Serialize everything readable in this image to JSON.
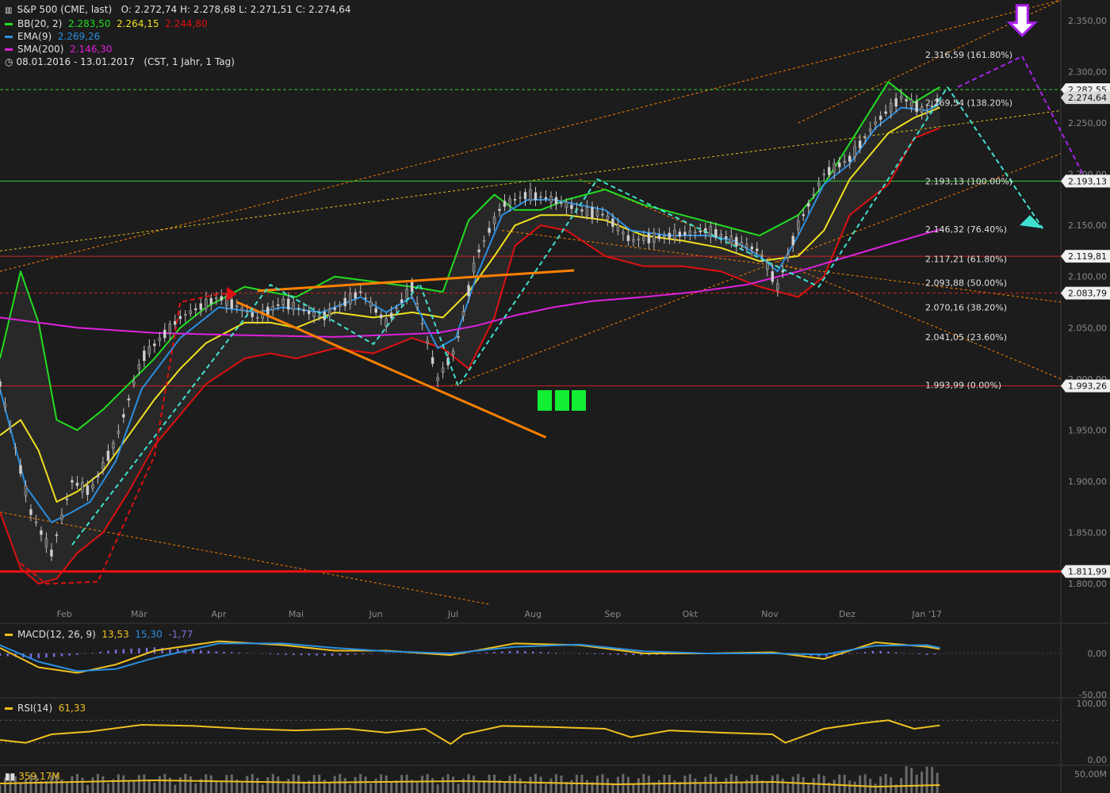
{
  "header": {
    "symbol_icon": "candlestick-icon",
    "symbol": "S&P 500 (CME, last)",
    "ohlc": "O: 2.272,74   H: 2.278,68   L: 2.271,51   C: 2.274,64",
    "bb_label": "BB(20, 2)",
    "bb_values": [
      "2.283,50",
      "2.264,15",
      "2.244,80"
    ],
    "ema_label": "EMA(9)",
    "ema_value": "2.269,26",
    "sma_label": "SMA(200)",
    "sma_value": "2.146,30",
    "clock_icon": "clock-icon",
    "range": "08.01.2016 - 13.01.2017",
    "range_detail": "(CST, 1 Jahr, 1 Tag)"
  },
  "colors": {
    "background": "#1c1c1c",
    "bb_upper": "#22dd22",
    "bb_lower": "#dd1111",
    "bb_mid": "#f0e020",
    "ema": "#2a8ee0",
    "sma": "#dd22dd",
    "trend_orange": "#ff8000",
    "trend_cyan": "#40e0d0",
    "forecast_purple": "#aa22ee",
    "grid_green": "#33cc33",
    "grid_red": "#cc2222",
    "macd": "#f0c020",
    "macd_signal": "#2a8ee0",
    "macd_hist": "#7a70e0",
    "rsi": "#f0c020",
    "green_blocks": "#11ee33"
  },
  "chart_data": {
    "type": "line",
    "title": "S&P 500 (CME, last)",
    "xlabel": "",
    "ylabel": "",
    "ylim": [
      1780,
      2370
    ],
    "y_ticks": [
      1800,
      1850,
      1900,
      1950,
      2000,
      2050,
      2100,
      2150,
      2200,
      2250,
      2300,
      2350
    ],
    "y_tick_labels": [
      "1.800,00",
      "1.850,00",
      "1.900,00",
      "1.950,00",
      "2.000,00",
      "2.050,00",
      "2.100,00",
      "2.150,00",
      "2.200,00",
      "2.250,00",
      "2.300,00",
      "2.350,00"
    ],
    "x_labels": [
      "Feb",
      "Mär",
      "Apr",
      "Mai",
      "Jun",
      "Jul",
      "Aug",
      "Sep",
      "Okt",
      "Nov",
      "Dez",
      "Jan '17"
    ],
    "x_label_days": [
      25,
      54,
      85,
      115,
      146,
      176,
      207,
      238,
      268,
      299,
      329,
      360
    ],
    "x_days_range": [
      0,
      412
    ],
    "grid": false,
    "legend_position": "top-left",
    "series": [
      {
        "name": "S&P 500",
        "x": [
          0,
          12,
          20,
          28,
          35,
          45,
          55,
          70,
          85,
          100,
          110,
          125,
          140,
          150,
          160,
          170,
          177,
          185,
          195,
          205,
          215,
          225,
          235,
          245,
          260,
          275,
          285,
          295,
          302,
          310,
          320,
          330,
          340,
          350,
          360,
          365
        ],
        "y": [
          1995,
          1870,
          1830,
          1900,
          1890,
          1940,
          2020,
          2060,
          2080,
          2060,
          2075,
          2060,
          2085,
          2055,
          2090,
          2000,
          2030,
          2120,
          2170,
          2180,
          2175,
          2165,
          2160,
          2135,
          2140,
          2145,
          2135,
          2125,
          2090,
          2150,
          2200,
          2215,
          2250,
          2275,
          2260,
          2275
        ]
      },
      {
        "name": "BB(20, 2)",
        "x": [
          0,
          8,
          15,
          22,
          30,
          40,
          50,
          60,
          70,
          80,
          95,
          105,
          115,
          130,
          145,
          160,
          172,
          182,
          192,
          200,
          210,
          220,
          235,
          250,
          265,
          280,
          295,
          310,
          320,
          330,
          345,
          355,
          365
        ],
        "y": [
          2020,
          2105,
          2055,
          1960,
          1950,
          1970,
          1995,
          2020,
          2050,
          2070,
          2090,
          2085,
          2080,
          2100,
          2095,
          2090,
          2085,
          2155,
          2180,
          2165,
          2165,
          2175,
          2185,
          2170,
          2160,
          2150,
          2140,
          2160,
          2190,
          2230,
          2290,
          2270,
          2285
        ]
      },
      {
        "name": "BB(20, 2)",
        "x": [
          0,
          8,
          15,
          22,
          30,
          40,
          50,
          60,
          70,
          80,
          95,
          105,
          115,
          130,
          145,
          160,
          172,
          182,
          192,
          200,
          210,
          220,
          235,
          250,
          265,
          280,
          295,
          310,
          320,
          330,
          345,
          355,
          365
        ],
        "y": [
          1870,
          1815,
          1800,
          1805,
          1830,
          1850,
          1890,
          1935,
          1965,
          1995,
          2020,
          2025,
          2020,
          2030,
          2025,
          2040,
          2030,
          2010,
          2060,
          2130,
          2150,
          2145,
          2120,
          2110,
          2110,
          2105,
          2090,
          2080,
          2100,
          2160,
          2190,
          2235,
          2245
        ]
      },
      {
        "name": "BB(20, 2)",
        "x": [
          0,
          8,
          15,
          22,
          30,
          40,
          50,
          60,
          70,
          80,
          95,
          105,
          115,
          130,
          145,
          160,
          172,
          182,
          192,
          200,
          210,
          220,
          235,
          250,
          265,
          280,
          295,
          310,
          320,
          330,
          345,
          355,
          365
        ],
        "y": [
          1945,
          1960,
          1930,
          1880,
          1890,
          1910,
          1945,
          1980,
          2010,
          2035,
          2055,
          2055,
          2050,
          2065,
          2060,
          2065,
          2060,
          2085,
          2120,
          2150,
          2160,
          2160,
          2155,
          2140,
          2135,
          2128,
          2115,
          2120,
          2145,
          2195,
          2240,
          2255,
          2265
        ]
      },
      {
        "name": "EMA(9)",
        "x": [
          0,
          10,
          20,
          28,
          35,
          45,
          55,
          70,
          85,
          100,
          110,
          125,
          140,
          150,
          160,
          170,
          177,
          185,
          195,
          205,
          215,
          225,
          235,
          245,
          260,
          275,
          285,
          295,
          302,
          310,
          320,
          330,
          340,
          350,
          360,
          365
        ],
        "y": [
          1990,
          1895,
          1860,
          1870,
          1880,
          1920,
          1990,
          2040,
          2070,
          2065,
          2070,
          2065,
          2080,
          2065,
          2080,
          2030,
          2040,
          2100,
          2160,
          2175,
          2175,
          2170,
          2165,
          2145,
          2140,
          2140,
          2135,
          2120,
          2105,
          2140,
          2190,
          2210,
          2245,
          2265,
          2262,
          2269
        ]
      },
      {
        "name": "SMA(200)",
        "x": [
          0,
          30,
          60,
          90,
          110,
          130,
          150,
          170,
          185,
          200,
          215,
          230,
          250,
          270,
          290,
          310,
          330,
          350,
          365
        ],
        "y": [
          2060,
          2050,
          2045,
          2043,
          2042,
          2041,
          2043,
          2045,
          2052,
          2062,
          2070,
          2076,
          2080,
          2085,
          2092,
          2105,
          2120,
          2135,
          2146
        ]
      }
    ],
    "horizontal_levels": [
      {
        "label": "2.282,55",
        "value": 2282.55
      },
      {
        "label": "2.274,64",
        "value": 2274.64
      },
      {
        "label": "2.193,13",
        "value": 2193.13
      },
      {
        "label": "2.119,81",
        "value": 2119.81
      },
      {
        "label": "2.083,79",
        "value": 2083.79
      },
      {
        "label": "1.993,26",
        "value": 1993.26
      },
      {
        "label": "1.811,99",
        "value": 1811.99
      }
    ],
    "fibonacci": [
      {
        "label": "2.316,59 (161.80%)",
        "value": 2316.59
      },
      {
        "label": "2.269,54 (138.20%)",
        "value": 2269.54
      },
      {
        "label": "2.193,13 (100.00%)",
        "value": 2193.13
      },
      {
        "label": "2.146,32 (76.40%)",
        "value": 2146.32
      },
      {
        "label": "2.117,21 (61.80%)",
        "value": 2117.21
      },
      {
        "label": "2.093,88 (50.00%)",
        "value": 2093.88
      },
      {
        "label": "2.070,16 (38.20%)",
        "value": 2070.16
      },
      {
        "label": "2.041,05 (23.60%)",
        "value": 2041.05
      },
      {
        "label": "1.993,99 (0.00%)",
        "value": 1993.99
      }
    ]
  },
  "macd": {
    "label": "MACD(12, 26, 9)",
    "value": "13,53",
    "signal": "15,30",
    "hist": "-1,77",
    "y_labels": [
      "0,00",
      "-50,00"
    ]
  },
  "rsi": {
    "label": "RSI(14)",
    "value": "61,33",
    "y_labels": [
      "100,00",
      "0,00"
    ]
  },
  "volume": {
    "icon": "volume-bars-icon",
    "value": "359,17M",
    "y_label": "50,00M"
  }
}
